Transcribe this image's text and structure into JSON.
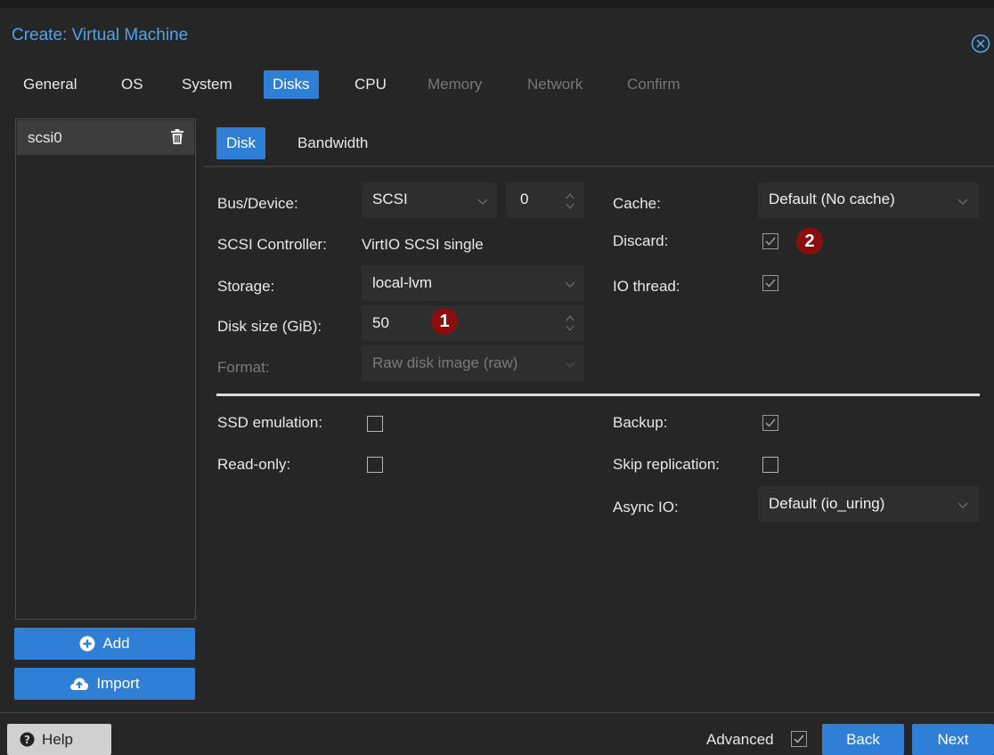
{
  "window": {
    "title": "Create: Virtual Machine"
  },
  "tabs": [
    {
      "label": "General",
      "state": "normal"
    },
    {
      "label": "OS",
      "state": "normal"
    },
    {
      "label": "System",
      "state": "normal"
    },
    {
      "label": "Disks",
      "state": "active"
    },
    {
      "label": "CPU",
      "state": "normal"
    },
    {
      "label": "Memory",
      "state": "disabled"
    },
    {
      "label": "Network",
      "state": "disabled"
    },
    {
      "label": "Confirm",
      "state": "disabled"
    }
  ],
  "disks": {
    "items": [
      {
        "label": "scsi0"
      }
    ],
    "add_label": "Add",
    "import_label": "Import"
  },
  "subtabs": [
    {
      "label": "Disk",
      "active": true
    },
    {
      "label": "Bandwidth",
      "active": false
    }
  ],
  "form": {
    "bus_device": {
      "label": "Bus/Device:",
      "bus": "SCSI",
      "device": "0"
    },
    "scsi_controller": {
      "label": "SCSI Controller:",
      "value": "VirtIO SCSI single"
    },
    "storage": {
      "label": "Storage:",
      "value": "local-lvm"
    },
    "disk_size": {
      "label": "Disk size (GiB):",
      "value": "50"
    },
    "format": {
      "label": "Format:",
      "value": "Raw disk image (raw)"
    },
    "cache": {
      "label": "Cache:",
      "value": "Default (No cache)"
    },
    "discard": {
      "label": "Discard:",
      "checked": true
    },
    "io_thread": {
      "label": "IO thread:",
      "checked": true
    },
    "ssd_emulation": {
      "label": "SSD emulation:",
      "checked": false
    },
    "read_only": {
      "label": "Read-only:",
      "checked": false
    },
    "backup": {
      "label": "Backup:",
      "checked": true
    },
    "skip_replication": {
      "label": "Skip replication:",
      "checked": false
    },
    "async_io": {
      "label": "Async IO:",
      "value": "Default (io_uring)"
    }
  },
  "annotations": {
    "badge1": "1",
    "badge2": "2"
  },
  "footer": {
    "help_label": "Help",
    "advanced_label": "Advanced",
    "advanced_checked": true,
    "back_label": "Back",
    "next_label": "Next"
  },
  "colors": {
    "accent": "#2f7fd7",
    "title": "#4fa3ee",
    "background": "#262626",
    "badge": "#8c0d0d"
  }
}
